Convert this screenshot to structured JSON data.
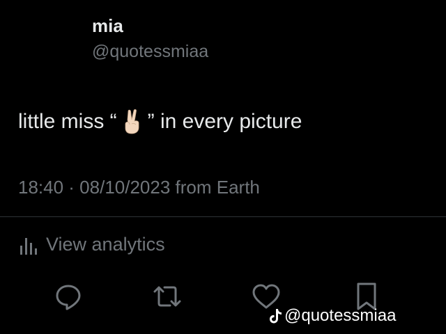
{
  "author": {
    "display_name": "mia",
    "handle": "@quotessmiaa"
  },
  "tweet": {
    "text_before": "little miss “",
    "emoji": "victory-hand-emoji",
    "text_after": "” in every picture",
    "meta": "18:40 · 08/10/2023 from Earth"
  },
  "analytics": {
    "label": "View analytics",
    "icon": "bar-chart-icon"
  },
  "actions": [
    {
      "icon": "reply-icon"
    },
    {
      "icon": "retweet-icon"
    },
    {
      "icon": "like-icon"
    },
    {
      "icon": "bookmark-icon"
    }
  ],
  "watermark": {
    "icon": "tiktok-logo",
    "text": "@quotessmiaa"
  },
  "colors": {
    "background": "#000000",
    "primary_text": "#e7e9ea",
    "secondary_text": "#71767b",
    "divider": "#2f3336"
  }
}
